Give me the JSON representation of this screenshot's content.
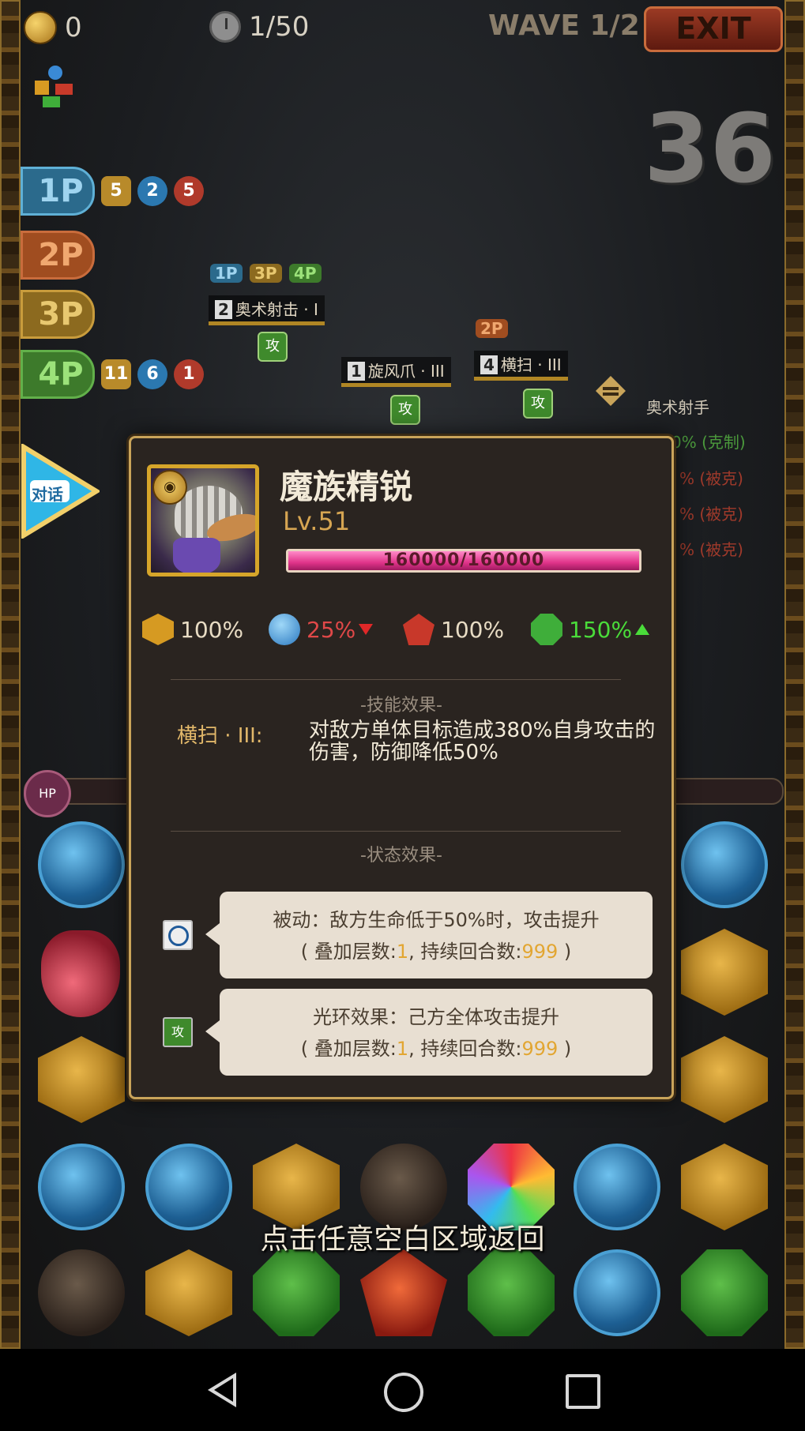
{
  "hud": {
    "coins": "0",
    "turns": "1/50",
    "wave": "WAVE 1/2",
    "exit_label": "EXIT",
    "countdown": "36"
  },
  "players": [
    {
      "label": "1P",
      "chips": [
        "5",
        "2",
        "5"
      ]
    },
    {
      "label": "2P",
      "chips": []
    },
    {
      "label": "3P",
      "chips": []
    },
    {
      "label": "4P",
      "chips": [
        "11",
        "6",
        "1"
      ]
    }
  ],
  "enemies": [
    {
      "index": "2",
      "skill": "奥术射击 · I",
      "players": [
        "1P",
        "3P",
        "4P"
      ]
    },
    {
      "index": "1",
      "skill": "旋风爪 · III",
      "players": []
    },
    {
      "index": "4",
      "skill": "横扫 · III",
      "players": [
        "2P"
      ]
    }
  ],
  "side": {
    "archer": "奥术射手",
    "lines": [
      "0% (克制)",
      "% (被克)",
      "% (被克)",
      "% (被克)"
    ]
  },
  "talk_label": "对话",
  "modal": {
    "name": "魔族精锐",
    "level": "Lv.51",
    "hp_text": "160000/160000",
    "hp_fraction": 1.0,
    "attributes": [
      {
        "icon": "gold-hexagon-icon",
        "value": "100%",
        "color": "#e8dcc4",
        "trend": "none"
      },
      {
        "icon": "water-drop-icon",
        "value": "25%",
        "color": "#e04848",
        "trend": "down"
      },
      {
        "icon": "fire-crystal-icon",
        "value": "100%",
        "color": "#e8dcc4",
        "trend": "none"
      },
      {
        "icon": "wind-swirl-icon",
        "value": "150%",
        "color": "#4adc3a",
        "trend": "up"
      }
    ],
    "skill_section_title": "-技能效果-",
    "skill_name": "横扫 · III:",
    "skill_desc": "对敌方单体目标造成380%自身攻击的伤害，防御降低50%",
    "status_section_title": "-状态效果-",
    "statuses": [
      {
        "icon": "target-icon",
        "line1": "被动：敌方生命低于50%时，攻击提升",
        "stack_prefix": "( 叠加层数:",
        "stack_value": "1",
        "turns_prefix": ", 持续回合数:",
        "turns_value": "999",
        "suffix": " )"
      },
      {
        "icon": "attack-icon",
        "icon_text": "攻",
        "line1": "光环效果：己方全体攻击提升",
        "stack_prefix": "( 叠加层数:",
        "stack_value": "1",
        "turns_prefix": ", 持续回合数:",
        "turns_value": "999",
        "suffix": " )"
      }
    ]
  },
  "return_hint": "点击任意空白区域返回"
}
